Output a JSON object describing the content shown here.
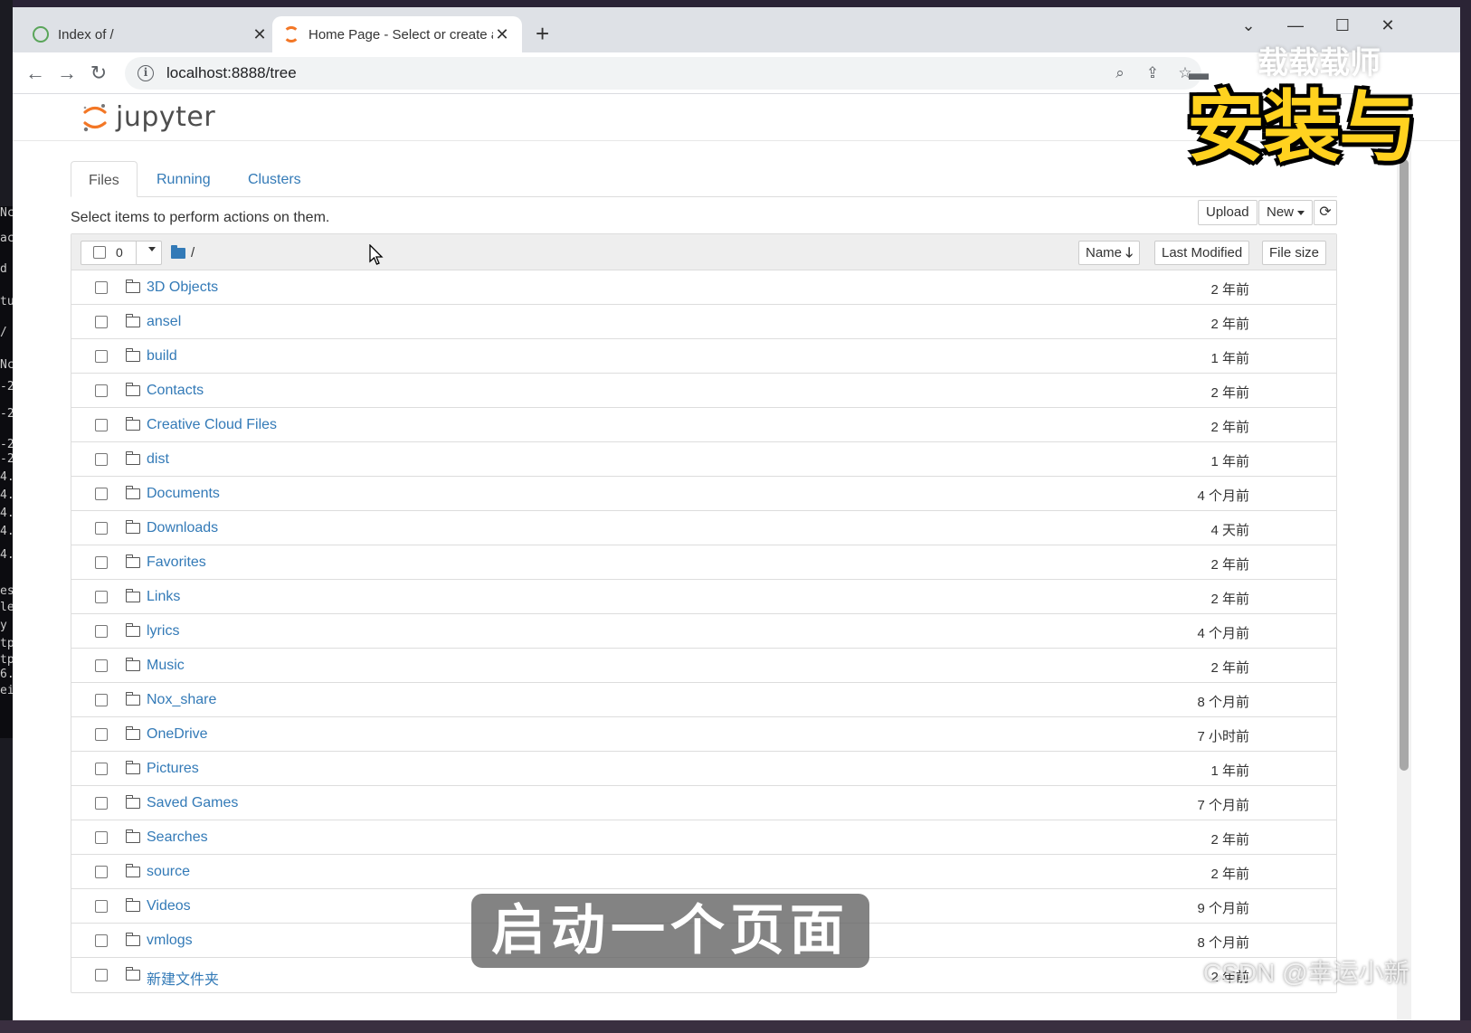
{
  "browser": {
    "tabs": [
      {
        "title": "Index of /",
        "active": false
      },
      {
        "title": "Home Page - Select or create a",
        "active": true
      }
    ],
    "url": "localhost:8888/tree"
  },
  "jupyter": {
    "logo_text": "jupyter",
    "tabs": [
      "Files",
      "Running",
      "Clusters"
    ],
    "hint": "Select items to perform actions on them.",
    "buttons": {
      "upload": "Upload",
      "new": "New"
    },
    "list_header": {
      "selected_count": "0",
      "breadcrumb": "/",
      "col_name": "Name",
      "col_modified": "Last Modified",
      "col_size": "File size"
    },
    "items": [
      {
        "name": "3D Objects",
        "modified": "2 年前"
      },
      {
        "name": "ansel",
        "modified": "2 年前"
      },
      {
        "name": "build",
        "modified": "1 年前"
      },
      {
        "name": "Contacts",
        "modified": "2 年前"
      },
      {
        "name": "Creative Cloud Files",
        "modified": "2 年前"
      },
      {
        "name": "dist",
        "modified": "1 年前"
      },
      {
        "name": "Documents",
        "modified": "4 个月前"
      },
      {
        "name": "Downloads",
        "modified": "4 天前"
      },
      {
        "name": "Favorites",
        "modified": "2 年前"
      },
      {
        "name": "Links",
        "modified": "2 年前"
      },
      {
        "name": "lyrics",
        "modified": "4 个月前"
      },
      {
        "name": "Music",
        "modified": "2 年前"
      },
      {
        "name": "Nox_share",
        "modified": "8 个月前"
      },
      {
        "name": "OneDrive",
        "modified": "7 小时前"
      },
      {
        "name": "Pictures",
        "modified": "1 年前"
      },
      {
        "name": "Saved Games",
        "modified": "7 个月前"
      },
      {
        "name": "Searches",
        "modified": "2 年前"
      },
      {
        "name": "source",
        "modified": "2 年前"
      },
      {
        "name": "Videos",
        "modified": "9 个月前"
      },
      {
        "name": "vmlogs",
        "modified": "8 个月前"
      },
      {
        "name": "新建文件夹",
        "modified": "2 年前"
      }
    ]
  },
  "overlays": {
    "title": "安装与",
    "title_top": "载载载师",
    "subtitle": "启动一个页面",
    "watermark": "CSDN @幸运小新"
  },
  "terminal_fragments": [
    "Nc",
    "ac",
    "d",
    "tu",
    "/",
    "Nc",
    "-2",
    "-2",
    "-2",
    "-2",
    "4.",
    "4.",
    "4.",
    "4.",
    "4.",
    "es",
    "le",
    "y",
    "tp",
    "tp",
    "6.",
    "ei"
  ],
  "colors": {
    "link": "#337ab7",
    "jupyter_orange": "#f37726",
    "overlay_yellow": "#ffd21f"
  }
}
